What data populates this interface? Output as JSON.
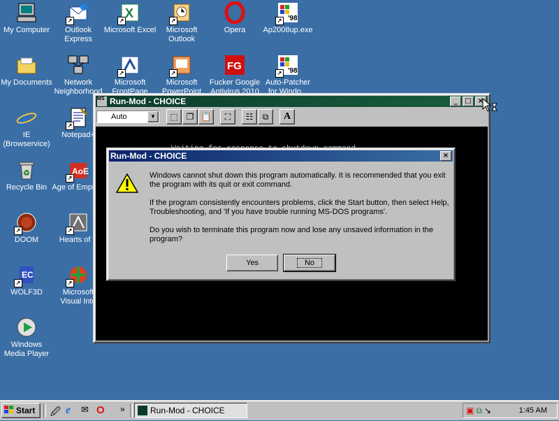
{
  "desktop": {
    "icons": [
      {
        "label": "My Computer",
        "icon": "computer-icon"
      },
      {
        "label": "Outlook Express",
        "icon": "outlook-express-icon"
      },
      {
        "label": "Microsoft Excel",
        "icon": "excel-icon"
      },
      {
        "label": "Microsoft Outlook",
        "icon": "outlook-icon"
      },
      {
        "label": "Opera",
        "icon": "opera-icon"
      },
      {
        "label": "Ap2008up.exe",
        "icon": "windows98-exe-icon"
      },
      {
        "label": "My Documents",
        "icon": "folder-icon"
      },
      {
        "label": "Network Neighborhood",
        "icon": "network-icon"
      },
      {
        "label": "Microsoft FrontPage",
        "icon": "frontpage-icon"
      },
      {
        "label": "Microsoft PowerPoint",
        "icon": "powerpoint-icon"
      },
      {
        "label": "Fucker Google Antivirus 2010",
        "icon": "antivirus-icon"
      },
      {
        "label": "Auto-Patcher for Windo...",
        "icon": "windows98-patcher-icon"
      },
      {
        "label": "IE (Browservice)",
        "icon": "ie-icon"
      },
      {
        "label": "Notepad+",
        "icon": "notepad-icon"
      },
      {
        "label": "Recycle Bin",
        "icon": "recycle-bin-icon"
      },
      {
        "label": "Age of Empires",
        "icon": "age-of-empires-icon"
      },
      {
        "label": "DOOM",
        "icon": "doom-icon"
      },
      {
        "label": "Hearts of Ir",
        "icon": "hearts-of-iron-icon"
      },
      {
        "label": "WOLF3D",
        "icon": "wolf3d-icon"
      },
      {
        "label": "Microsoft Visual Inte",
        "icon": "visual-interdev-icon"
      },
      {
        "label": "Windows Media Player",
        "icon": "media-player-icon"
      }
    ]
  },
  "dos_window": {
    "title": "Run-Mod - CHOICE",
    "sys_icon_text": "MS",
    "font_select": "Auto",
    "font_label": "A",
    "background_text": "Waiting for response to shutdown command"
  },
  "dialog": {
    "title": "Run-Mod - CHOICE",
    "para1": "Windows cannot shut down this program automatically.  It is recommended that you exit the program with its quit or exit command.",
    "para2": "If the program consistently encounters problems, click the Start button, then select Help, Troubleshooting, and 'If you have trouble running MS-DOS programs'.",
    "para3": "Do you wish to terminate this program now and lose any unsaved information in the program?",
    "yes_label": "Yes",
    "no_label": "No",
    "close_glyph": "×"
  },
  "taskbar": {
    "start_label": "Start",
    "chevron": "»",
    "task_title": "Run-Mod - CHOICE",
    "clock": "1:45 AM"
  },
  "colors": {
    "desktop": "#3a6ea5",
    "face": "#c0c0c0",
    "active_title": "#0a246a",
    "inactive_title": "#0a3b2a"
  }
}
